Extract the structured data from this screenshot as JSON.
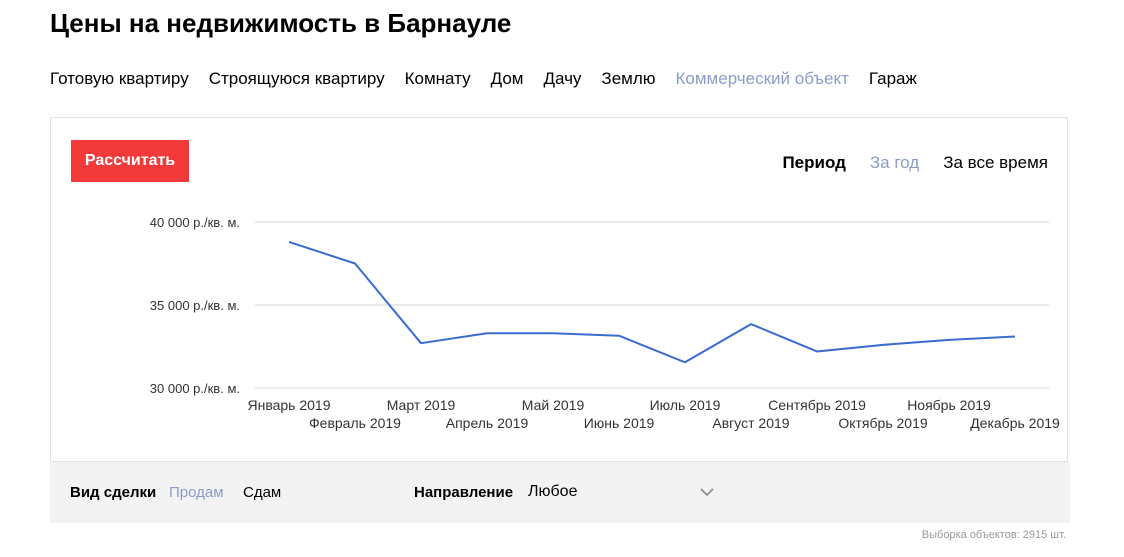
{
  "page": {
    "title": "Цены на недвижимость в Барнауле"
  },
  "tabs": [
    {
      "label": "Готовую квартиру",
      "active": false
    },
    {
      "label": "Строящуюся квартиру",
      "active": false
    },
    {
      "label": "Комнату",
      "active": false
    },
    {
      "label": "Дом",
      "active": false
    },
    {
      "label": "Дачу",
      "active": false
    },
    {
      "label": "Землю",
      "active": false
    },
    {
      "label": "Коммерческий объект",
      "active": true
    },
    {
      "label": "Гараж",
      "active": false
    }
  ],
  "controls": {
    "calculate_label": "Рассчитать",
    "period_label": "Период",
    "period_options": [
      {
        "label": "За год",
        "active": true
      },
      {
        "label": "За все время",
        "active": false
      }
    ]
  },
  "chart_data": {
    "type": "line",
    "x": [
      "Январь 2019",
      "Февраль 2019",
      "Март 2019",
      "Апрель 2019",
      "Май 2019",
      "Июнь 2019",
      "Июль 2019",
      "Август 2019",
      "Сентябрь 2019",
      "Октябрь 2019",
      "Ноябрь 2019",
      "Декабрь 2019"
    ],
    "series": [
      {
        "values": [
          38800,
          37500,
          32700,
          33300,
          33300,
          33150,
          31550,
          33850,
          32200,
          32600,
          32900,
          33100
        ]
      }
    ],
    "yticks": [
      {
        "value": 40000,
        "label": "40 000 р./кв. м."
      },
      {
        "value": 35000,
        "label": "35 000 р./кв. м."
      },
      {
        "value": 30000,
        "label": "30 000 р./кв. м."
      }
    ],
    "ylim": [
      30000,
      40000
    ],
    "grid": true,
    "line_color": "#3a6bd0",
    "grid_color": "#d6d6d6"
  },
  "filters": {
    "deal_label": "Вид сделки",
    "deal_options": [
      {
        "label": "Продам",
        "active": true
      },
      {
        "label": "Сдам",
        "active": false
      }
    ],
    "direction_label": "Направление",
    "direction_value": "Любое"
  },
  "footer": {
    "sample_count": "Выборка объектов: 2915 шт."
  },
  "colors": {
    "accent_red": "#f23a3a",
    "active_link": "#8a9cc7"
  }
}
